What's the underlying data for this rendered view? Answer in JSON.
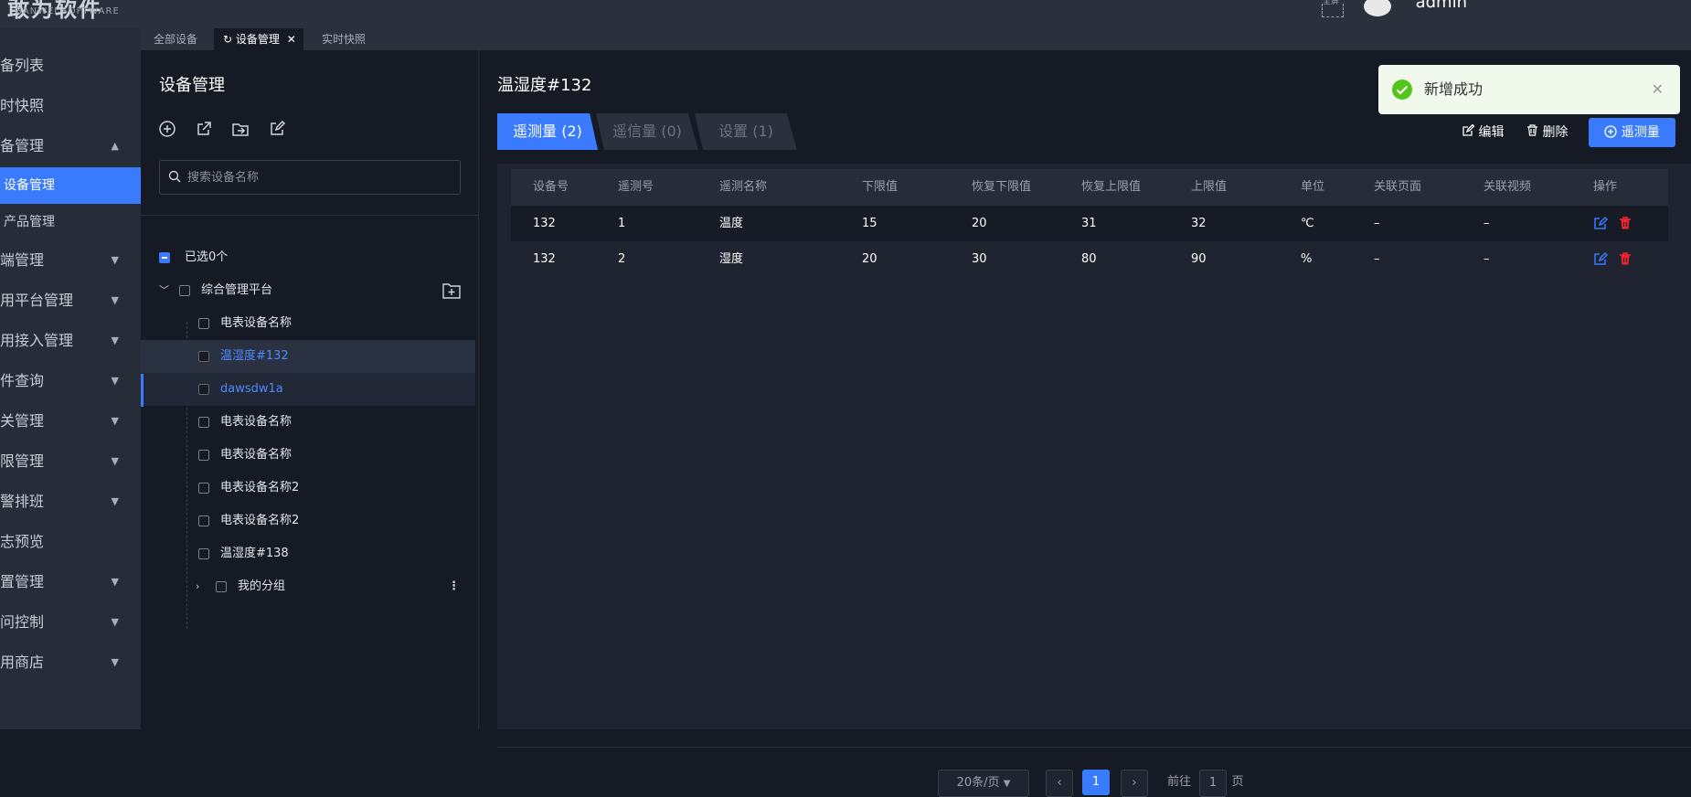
{
  "app": {
    "logo_text": "敢为软件",
    "logo_sub": "GANWEI  SOFTWARE",
    "user": "admin",
    "fullscreen_label": "全屏"
  },
  "tabs": [
    {
      "label": "全部设备"
    },
    {
      "label": "设备管理",
      "close": "✕"
    },
    {
      "label": "实时快照"
    }
  ],
  "sidebar": {
    "items": [
      {
        "label": "设备列表"
      },
      {
        "label": "实时快照"
      },
      {
        "label": "设备管理"
      },
      {
        "label": "设备管理"
      },
      {
        "label": "产品管理"
      },
      {
        "label": "终端管理"
      },
      {
        "label": "应用平台管理"
      },
      {
        "label": "应用接入管理"
      },
      {
        "label": "事件查询"
      },
      {
        "label": "网关管理"
      },
      {
        "label": "权限管理"
      },
      {
        "label": "报警排班"
      },
      {
        "label": "日志预览"
      },
      {
        "label": "配置管理"
      },
      {
        "label": "访问控制"
      },
      {
        "label": "应用商店"
      }
    ]
  },
  "tree": {
    "title": "设备管理",
    "search_placeholder": "搜索设备名称",
    "selected_count": "已选0个",
    "root": "综合管理平台",
    "children": [
      "电表设备名称",
      "温湿度#132",
      "dawsdw1a",
      "电表设备名称",
      "电表设备名称",
      "电表设备名称2",
      "电表设备名称2",
      "温湿度#138"
    ],
    "group": "我的分组"
  },
  "detail": {
    "title": "温湿度#132",
    "tabs": [
      "遥测量 (2)",
      "遥信量 (0)",
      "设置 (1)"
    ],
    "actions": {
      "edit": "编辑",
      "delete": "删除",
      "add": "遥测量"
    },
    "columns": [
      "设备号",
      "遥测号",
      "遥测名称",
      "下限值",
      "恢复下限值",
      "恢复上限值",
      "上限值",
      "单位",
      "关联页面",
      "关联视频",
      "操作"
    ],
    "rows": [
      [
        "132",
        "1",
        "温度",
        "15",
        "20",
        "31",
        "32",
        "℃",
        "–",
        "–"
      ],
      [
        "132",
        "2",
        "湿度",
        "20",
        "30",
        "80",
        "90",
        "%",
        "–",
        "–"
      ]
    ],
    "pagination": {
      "page_size": "20条/页",
      "current": "1",
      "goto": "前往",
      "goto_value": "1",
      "page_unit": "页"
    }
  },
  "toast": {
    "message": "新增成功"
  },
  "colors": {
    "accent": "#3a7afc",
    "success": "#52c41a",
    "danger": "#f5222d"
  }
}
